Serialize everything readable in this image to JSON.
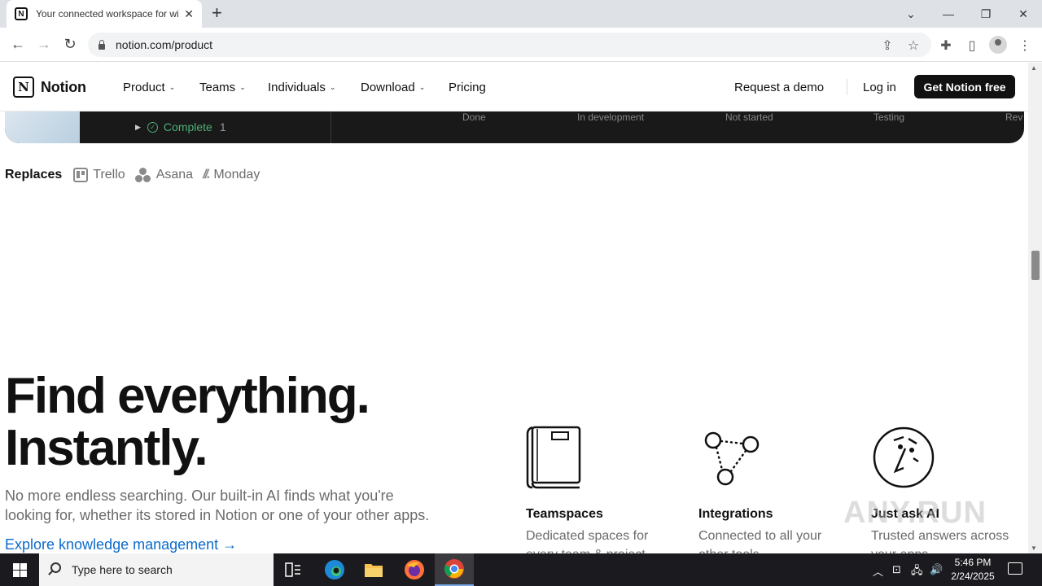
{
  "browser": {
    "tab_title": "Your connected workspace for wiki, docs & projects | Notion",
    "favicon_letter": "N",
    "tab_close": "✕",
    "new_tab": "+",
    "url": "notion.com/product",
    "window": {
      "minimize": "—",
      "restore": "❐",
      "close": "✕",
      "tab_search": "⌄"
    }
  },
  "nav": {
    "brand": "Notion",
    "items": [
      {
        "label": "Product"
      },
      {
        "label": "Teams"
      },
      {
        "label": "Individuals"
      },
      {
        "label": "Download"
      },
      {
        "label": "Pricing"
      }
    ],
    "request_demo": "Request a demo",
    "login": "Log in",
    "cta": "Get Notion free"
  },
  "board": {
    "group_label": "Complete",
    "group_count": "1",
    "status_columns": [
      "Done",
      "In development",
      "Not started",
      "Testing",
      "Rev"
    ]
  },
  "replaces": {
    "label": "Replaces",
    "tools": [
      "Trello",
      "Asana",
      "Monday"
    ]
  },
  "section": {
    "headline_1": "Find everything.",
    "headline_2": "Instantly.",
    "description_1": "No more endless searching. Our built-in AI finds what you're",
    "description_2": "looking for, whether its stored in Notion or one of your other apps.",
    "link": "Explore knowledge management →",
    "features": [
      {
        "title": "Teamspaces",
        "desc_1": "Dedicated spaces for",
        "desc_2": "every team & project.",
        "icon": "book-icon"
      },
      {
        "title": "Integrations",
        "desc_1": "Connected to all your",
        "desc_2": "other tools.",
        "icon": "nodes-icon"
      },
      {
        "title": "Just ask AI",
        "desc_1": "Trusted answers across",
        "desc_2": "your apps.",
        "icon": "ai-face-icon"
      }
    ]
  },
  "watermark": "ANY.RUN",
  "taskbar": {
    "search_placeholder": "Type here to search",
    "time": "5:46 PM",
    "date": "2/24/2025"
  }
}
